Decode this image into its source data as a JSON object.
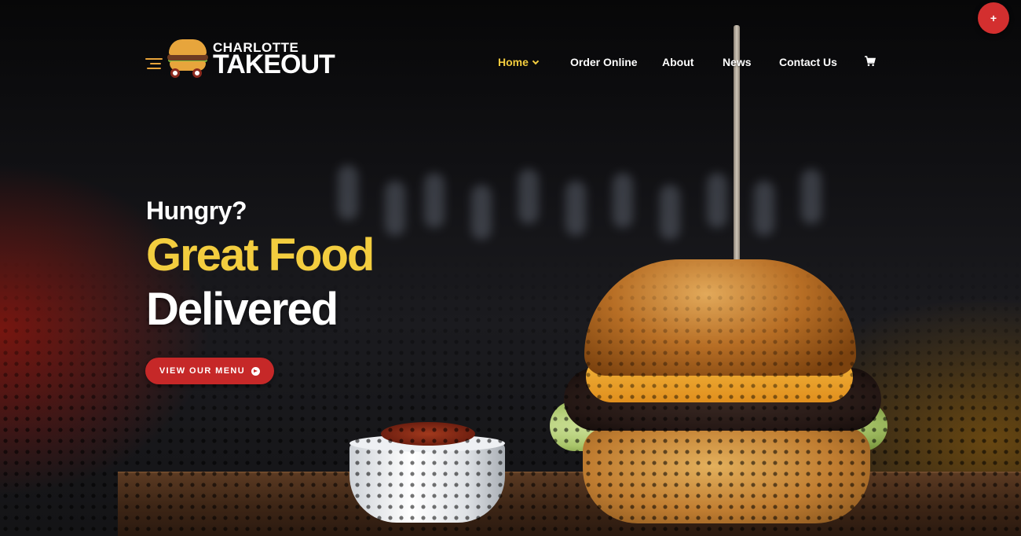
{
  "brand": {
    "name_top": "CHARLOTTE",
    "name_main": "TAKEOUT",
    "logo_icon": "burger-cart-icon"
  },
  "nav": {
    "items": [
      {
        "label": "Home",
        "active": true,
        "has_dropdown": true
      },
      {
        "label": "Order Online"
      },
      {
        "label": "About"
      },
      {
        "label": "News"
      },
      {
        "label": "Contact Us"
      }
    ],
    "cart_icon": "cart-icon"
  },
  "fab": {
    "label": "+"
  },
  "hero": {
    "line1": "Hungry?",
    "line2": "Great Food",
    "line3": "Delivered",
    "cta_label": "VIEW OUR MENU",
    "cta_icon": "arrow-circle-right-icon"
  },
  "colors": {
    "accent_yellow": "#f3cd3f",
    "brand_red": "#c62828"
  }
}
